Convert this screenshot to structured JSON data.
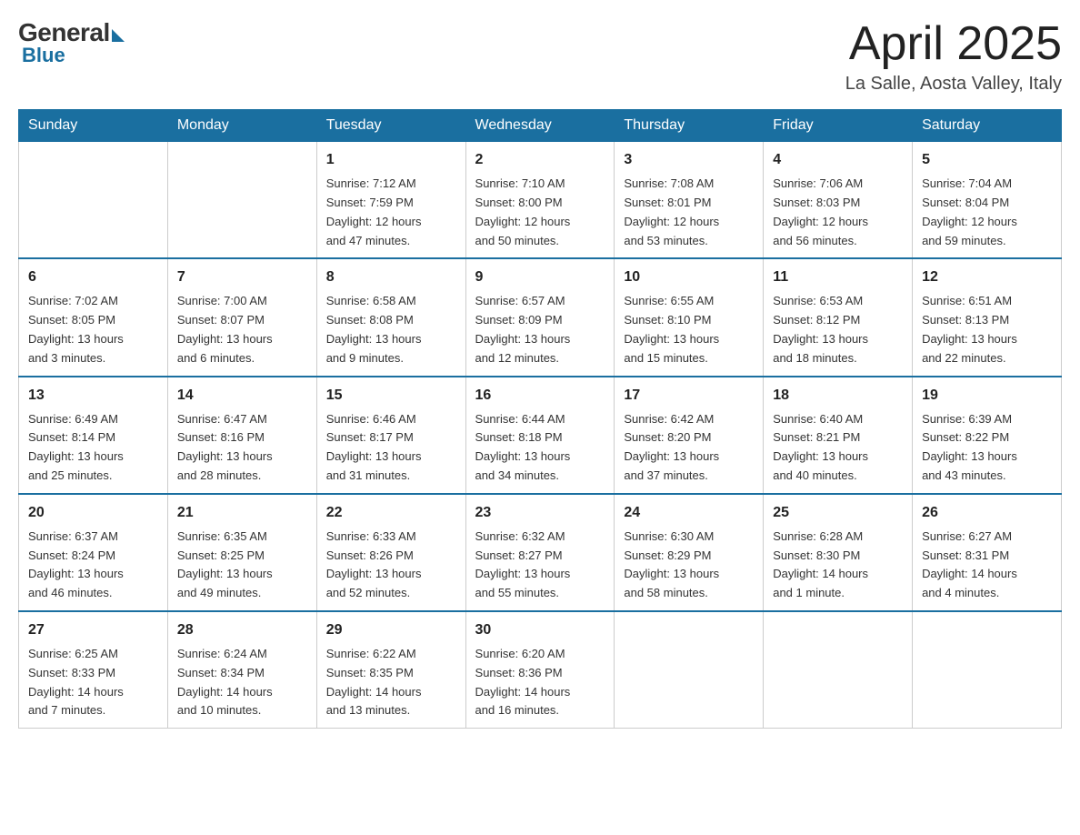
{
  "logo": {
    "general": "General",
    "blue": "Blue"
  },
  "title": {
    "month_year": "April 2025",
    "location": "La Salle, Aosta Valley, Italy"
  },
  "weekdays": [
    "Sunday",
    "Monday",
    "Tuesday",
    "Wednesday",
    "Thursday",
    "Friday",
    "Saturday"
  ],
  "weeks": [
    [
      {
        "day": "",
        "info": ""
      },
      {
        "day": "",
        "info": ""
      },
      {
        "day": "1",
        "info": "Sunrise: 7:12 AM\nSunset: 7:59 PM\nDaylight: 12 hours\nand 47 minutes."
      },
      {
        "day": "2",
        "info": "Sunrise: 7:10 AM\nSunset: 8:00 PM\nDaylight: 12 hours\nand 50 minutes."
      },
      {
        "day": "3",
        "info": "Sunrise: 7:08 AM\nSunset: 8:01 PM\nDaylight: 12 hours\nand 53 minutes."
      },
      {
        "day": "4",
        "info": "Sunrise: 7:06 AM\nSunset: 8:03 PM\nDaylight: 12 hours\nand 56 minutes."
      },
      {
        "day": "5",
        "info": "Sunrise: 7:04 AM\nSunset: 8:04 PM\nDaylight: 12 hours\nand 59 minutes."
      }
    ],
    [
      {
        "day": "6",
        "info": "Sunrise: 7:02 AM\nSunset: 8:05 PM\nDaylight: 13 hours\nand 3 minutes."
      },
      {
        "day": "7",
        "info": "Sunrise: 7:00 AM\nSunset: 8:07 PM\nDaylight: 13 hours\nand 6 minutes."
      },
      {
        "day": "8",
        "info": "Sunrise: 6:58 AM\nSunset: 8:08 PM\nDaylight: 13 hours\nand 9 minutes."
      },
      {
        "day": "9",
        "info": "Sunrise: 6:57 AM\nSunset: 8:09 PM\nDaylight: 13 hours\nand 12 minutes."
      },
      {
        "day": "10",
        "info": "Sunrise: 6:55 AM\nSunset: 8:10 PM\nDaylight: 13 hours\nand 15 minutes."
      },
      {
        "day": "11",
        "info": "Sunrise: 6:53 AM\nSunset: 8:12 PM\nDaylight: 13 hours\nand 18 minutes."
      },
      {
        "day": "12",
        "info": "Sunrise: 6:51 AM\nSunset: 8:13 PM\nDaylight: 13 hours\nand 22 minutes."
      }
    ],
    [
      {
        "day": "13",
        "info": "Sunrise: 6:49 AM\nSunset: 8:14 PM\nDaylight: 13 hours\nand 25 minutes."
      },
      {
        "day": "14",
        "info": "Sunrise: 6:47 AM\nSunset: 8:16 PM\nDaylight: 13 hours\nand 28 minutes."
      },
      {
        "day": "15",
        "info": "Sunrise: 6:46 AM\nSunset: 8:17 PM\nDaylight: 13 hours\nand 31 minutes."
      },
      {
        "day": "16",
        "info": "Sunrise: 6:44 AM\nSunset: 8:18 PM\nDaylight: 13 hours\nand 34 minutes."
      },
      {
        "day": "17",
        "info": "Sunrise: 6:42 AM\nSunset: 8:20 PM\nDaylight: 13 hours\nand 37 minutes."
      },
      {
        "day": "18",
        "info": "Sunrise: 6:40 AM\nSunset: 8:21 PM\nDaylight: 13 hours\nand 40 minutes."
      },
      {
        "day": "19",
        "info": "Sunrise: 6:39 AM\nSunset: 8:22 PM\nDaylight: 13 hours\nand 43 minutes."
      }
    ],
    [
      {
        "day": "20",
        "info": "Sunrise: 6:37 AM\nSunset: 8:24 PM\nDaylight: 13 hours\nand 46 minutes."
      },
      {
        "day": "21",
        "info": "Sunrise: 6:35 AM\nSunset: 8:25 PM\nDaylight: 13 hours\nand 49 minutes."
      },
      {
        "day": "22",
        "info": "Sunrise: 6:33 AM\nSunset: 8:26 PM\nDaylight: 13 hours\nand 52 minutes."
      },
      {
        "day": "23",
        "info": "Sunrise: 6:32 AM\nSunset: 8:27 PM\nDaylight: 13 hours\nand 55 minutes."
      },
      {
        "day": "24",
        "info": "Sunrise: 6:30 AM\nSunset: 8:29 PM\nDaylight: 13 hours\nand 58 minutes."
      },
      {
        "day": "25",
        "info": "Sunrise: 6:28 AM\nSunset: 8:30 PM\nDaylight: 14 hours\nand 1 minute."
      },
      {
        "day": "26",
        "info": "Sunrise: 6:27 AM\nSunset: 8:31 PM\nDaylight: 14 hours\nand 4 minutes."
      }
    ],
    [
      {
        "day": "27",
        "info": "Sunrise: 6:25 AM\nSunset: 8:33 PM\nDaylight: 14 hours\nand 7 minutes."
      },
      {
        "day": "28",
        "info": "Sunrise: 6:24 AM\nSunset: 8:34 PM\nDaylight: 14 hours\nand 10 minutes."
      },
      {
        "day": "29",
        "info": "Sunrise: 6:22 AM\nSunset: 8:35 PM\nDaylight: 14 hours\nand 13 minutes."
      },
      {
        "day": "30",
        "info": "Sunrise: 6:20 AM\nSunset: 8:36 PM\nDaylight: 14 hours\nand 16 minutes."
      },
      {
        "day": "",
        "info": ""
      },
      {
        "day": "",
        "info": ""
      },
      {
        "day": "",
        "info": ""
      }
    ]
  ]
}
